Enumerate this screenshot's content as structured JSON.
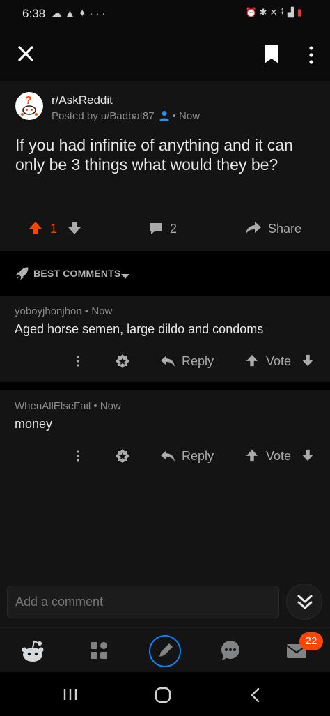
{
  "status_bar": {
    "time": "6:38",
    "left_icons": [
      "cloud-icon",
      "warning-icon",
      "twitter-icon",
      "more-horiz-icon"
    ],
    "right_icons": [
      "alarm-icon",
      "bluetooth-icon",
      "mute-icon",
      "wifi-icon",
      "signal-icon",
      "battery-low-icon"
    ]
  },
  "header": {
    "close_icon": "close-icon",
    "bookmark_icon": "bookmark-icon",
    "more_icon": "more-vert-icon"
  },
  "post": {
    "subreddit": "r/AskReddit",
    "posted_by": "Posted by u/Badbat87",
    "time": "• Now",
    "title": "If you had infinite of anything and it can only be 3 things what would they be?",
    "score": "1",
    "comment_count": "2",
    "share_label": "Share"
  },
  "sort": {
    "label": "BEST COMMENTS"
  },
  "comments": [
    {
      "meta": "yoboyjhonjhon • Now",
      "body": "Aged horse semen, large dildo and condoms",
      "reply_label": "Reply",
      "vote_label": "Vote"
    },
    {
      "meta": "WhenAllElseFail • Now",
      "body": "money",
      "reply_label": "Reply",
      "vote_label": "Vote"
    }
  ],
  "comment_bar": {
    "placeholder": "Add a comment"
  },
  "bottom_nav": {
    "inbox_badge": "22"
  },
  "colors": {
    "accent": "#ff4500",
    "post_button_ring": "#0a84ff",
    "background": "#0b0b0b",
    "card": "#141414"
  }
}
